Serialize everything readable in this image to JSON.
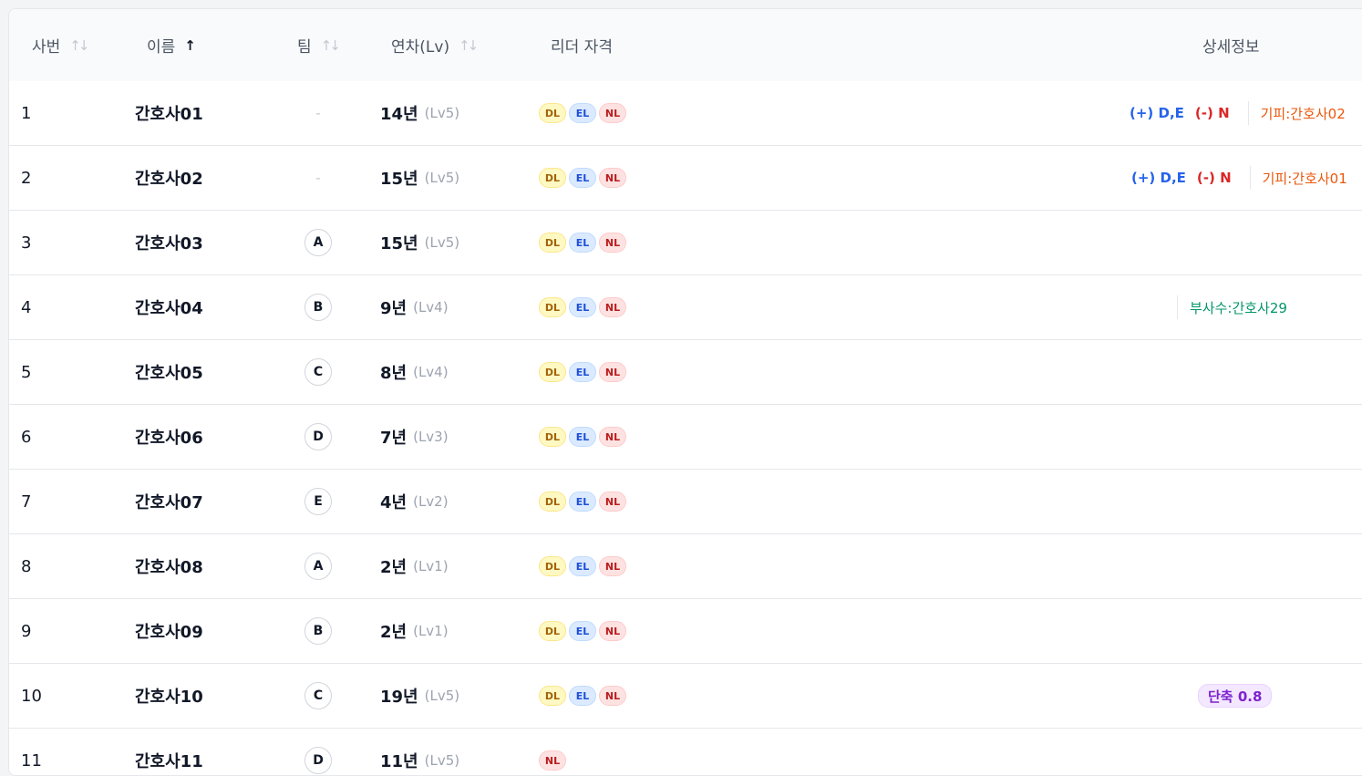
{
  "header": {
    "id": "사번",
    "name": "이름",
    "team": "팀",
    "years": "연차(Lv)",
    "leader": "리더 자격",
    "detail": "상세정보",
    "sort_icon": "↑↓",
    "sort_active_icon": "↑"
  },
  "rows": [
    {
      "id": "1",
      "name": "간호사01",
      "team": "-",
      "years": "14년",
      "lv": "(Lv5)",
      "leads": [
        "DL",
        "EL",
        "NL"
      ],
      "detail": {
        "plus": "(+) D,E",
        "minus": "(-) N",
        "avoid": "기피:간호사02"
      }
    },
    {
      "id": "2",
      "name": "간호사02",
      "team": "-",
      "years": "15년",
      "lv": "(Lv5)",
      "leads": [
        "DL",
        "EL",
        "NL"
      ],
      "detail": {
        "plus": "(+) D,E",
        "minus": "(-) N",
        "avoid": "기피:간호사01"
      }
    },
    {
      "id": "3",
      "name": "간호사03",
      "team": "A",
      "years": "15년",
      "lv": "(Lv5)",
      "leads": [
        "DL",
        "EL",
        "NL"
      ]
    },
    {
      "id": "4",
      "name": "간호사04",
      "team": "B",
      "years": "9년",
      "lv": "(Lv4)",
      "leads": [
        "DL",
        "EL",
        "NL"
      ],
      "detail": {
        "sub": "부사수:간호사29"
      }
    },
    {
      "id": "5",
      "name": "간호사05",
      "team": "C",
      "years": "8년",
      "lv": "(Lv4)",
      "leads": [
        "DL",
        "EL",
        "NL"
      ]
    },
    {
      "id": "6",
      "name": "간호사06",
      "team": "D",
      "years": "7년",
      "lv": "(Lv3)",
      "leads": [
        "DL",
        "EL",
        "NL"
      ]
    },
    {
      "id": "7",
      "name": "간호사07",
      "team": "E",
      "years": "4년",
      "lv": "(Lv2)",
      "leads": [
        "DL",
        "EL",
        "NL"
      ]
    },
    {
      "id": "8",
      "name": "간호사08",
      "team": "A",
      "years": "2년",
      "lv": "(Lv1)",
      "leads": [
        "DL",
        "EL",
        "NL"
      ]
    },
    {
      "id": "9",
      "name": "간호사09",
      "team": "B",
      "years": "2년",
      "lv": "(Lv1)",
      "leads": [
        "DL",
        "EL",
        "NL"
      ]
    },
    {
      "id": "10",
      "name": "간호사10",
      "team": "C",
      "years": "19년",
      "lv": "(Lv5)",
      "leads": [
        "DL",
        "EL",
        "NL"
      ],
      "detail": {
        "short": "단축 0.8"
      }
    },
    {
      "id": "11",
      "name": "간호사11",
      "team": "D",
      "years": "11년",
      "lv": "(Lv5)",
      "leads": [
        "NL"
      ]
    }
  ]
}
